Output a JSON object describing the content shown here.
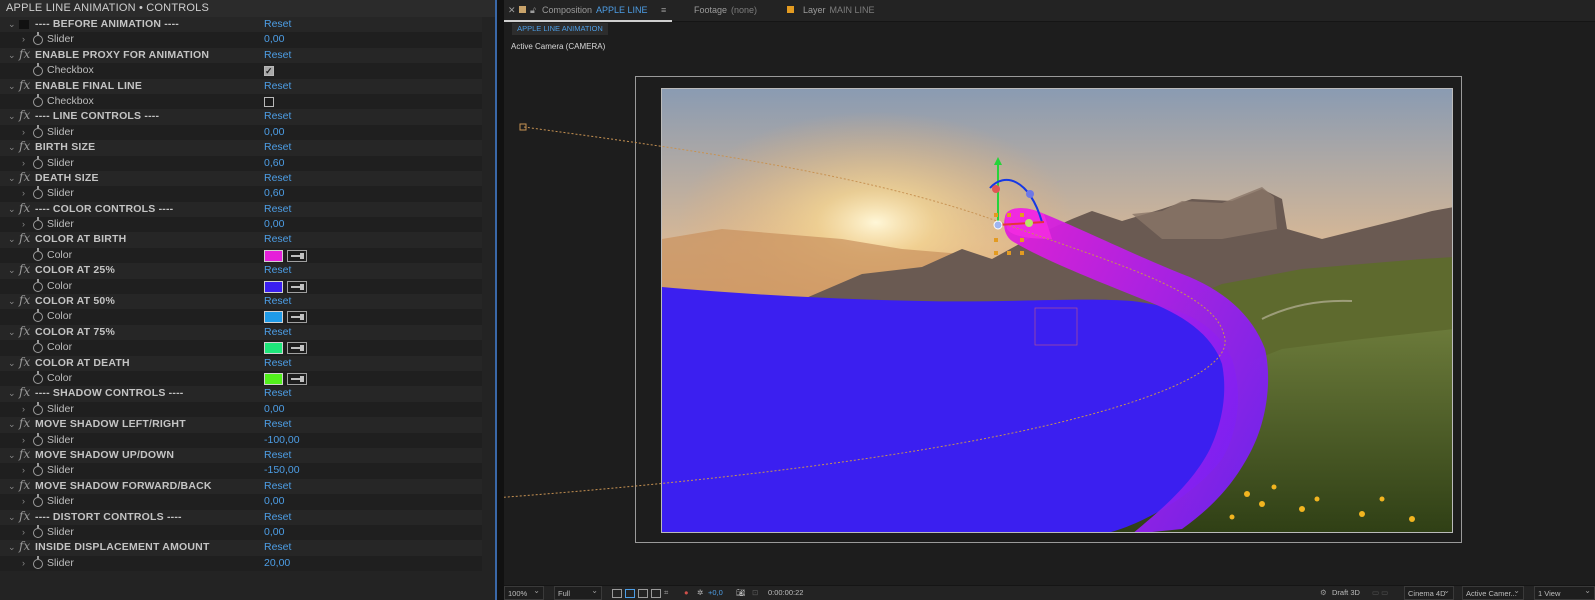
{
  "panel": {
    "title": "APPLE LINE ANIMATION • CONTROLS",
    "rows": [
      {
        "kind": "header",
        "fx": false,
        "name": "---- BEFORE ANIMATION ----",
        "action": "Reset"
      },
      {
        "kind": "param",
        "twirl": true,
        "param": "Slider",
        "value": "0,00"
      },
      {
        "kind": "header",
        "fx": true,
        "name": "ENABLE PROXY FOR ANIMATION",
        "action": "Reset"
      },
      {
        "kind": "checkbox",
        "param": "Checkbox",
        "checked": true
      },
      {
        "kind": "header",
        "fx": true,
        "name": "ENABLE FINAL LINE",
        "action": "Reset"
      },
      {
        "kind": "checkbox",
        "param": "Checkbox",
        "checked": false
      },
      {
        "kind": "header",
        "fx": true,
        "name": "---- LINE CONTROLS ----",
        "action": "Reset"
      },
      {
        "kind": "param",
        "twirl": true,
        "param": "Slider",
        "value": "0,00"
      },
      {
        "kind": "header",
        "fx": true,
        "name": "BIRTH SIZE",
        "action": "Reset"
      },
      {
        "kind": "param",
        "twirl": true,
        "param": "Slider",
        "value": "0,60"
      },
      {
        "kind": "header",
        "fx": true,
        "name": "DEATH SIZE",
        "action": "Reset"
      },
      {
        "kind": "param",
        "twirl": true,
        "param": "Slider",
        "value": "0,60"
      },
      {
        "kind": "header",
        "fx": true,
        "name": "---- COLOR CONTROLS ----",
        "action": "Reset"
      },
      {
        "kind": "param",
        "twirl": true,
        "param": "Slider",
        "value": "0,00"
      },
      {
        "kind": "header",
        "fx": true,
        "name": "COLOR AT BIRTH",
        "action": "Reset"
      },
      {
        "kind": "color",
        "param": "Color",
        "color": "#e51fd9"
      },
      {
        "kind": "header",
        "fx": true,
        "name": "COLOR AT 25%",
        "action": "Reset"
      },
      {
        "kind": "color",
        "param": "Color",
        "color": "#3b1ff0"
      },
      {
        "kind": "header",
        "fx": true,
        "name": "COLOR AT 50%",
        "action": "Reset"
      },
      {
        "kind": "color",
        "param": "Color",
        "color": "#1f9be8"
      },
      {
        "kind": "header",
        "fx": true,
        "name": "COLOR AT 75%",
        "action": "Reset"
      },
      {
        "kind": "color",
        "param": "Color",
        "color": "#1ee67a"
      },
      {
        "kind": "header",
        "fx": true,
        "name": "COLOR AT DEATH",
        "action": "Reset"
      },
      {
        "kind": "color",
        "param": "Color",
        "color": "#52f01c"
      },
      {
        "kind": "header",
        "fx": true,
        "name": "---- SHADOW CONTROLS ----",
        "action": "Reset"
      },
      {
        "kind": "param",
        "twirl": true,
        "param": "Slider",
        "value": "0,00"
      },
      {
        "kind": "header",
        "fx": true,
        "name": "MOVE SHADOW LEFT/RIGHT",
        "action": "Reset"
      },
      {
        "kind": "param",
        "twirl": true,
        "param": "Slider",
        "value": "-100,00"
      },
      {
        "kind": "header",
        "fx": true,
        "name": "MOVE SHADOW UP/DOWN",
        "action": "Reset"
      },
      {
        "kind": "param",
        "twirl": true,
        "param": "Slider",
        "value": "-150,00"
      },
      {
        "kind": "header",
        "fx": true,
        "name": "MOVE SHADOW FORWARD/BACK",
        "action": "Reset"
      },
      {
        "kind": "param",
        "twirl": true,
        "param": "Slider",
        "value": "0,00"
      },
      {
        "kind": "header",
        "fx": true,
        "name": "---- DISTORT CONTROLS ----",
        "action": "Reset"
      },
      {
        "kind": "param",
        "twirl": true,
        "param": "Slider",
        "value": "0,00"
      },
      {
        "kind": "header",
        "fx": true,
        "name": "INSIDE DISPLACEMENT AMOUNT",
        "action": "Reset"
      },
      {
        "kind": "param",
        "twirl": true,
        "param": "Slider",
        "value": "20,00"
      }
    ]
  },
  "viewer": {
    "tabs": {
      "composition": {
        "label": "Composition",
        "value": "APPLE LINE ANIMATION"
      },
      "footage": {
        "label": "Footage",
        "value": "(none)"
      },
      "layer": {
        "label": "Layer",
        "value": "MAIN LINE"
      }
    },
    "subtab": "APPLE LINE ANIMATION",
    "camera_label": "Active Camera (CAMERA)",
    "toolbar": {
      "zoom": "100%",
      "resolution": "Full",
      "exposure": "+0,0",
      "timecode": "0:00:00:22",
      "draft3d": "Draft 3D",
      "renderer": "Cinema 4D",
      "camera": "Active Camer...",
      "views": "1 View"
    }
  },
  "colors": {
    "accent": "#4d9ee6",
    "line_blue": "#3b1ff0",
    "line_magenta": "#e51fd9",
    "line_purple": "#8a1ff2"
  }
}
